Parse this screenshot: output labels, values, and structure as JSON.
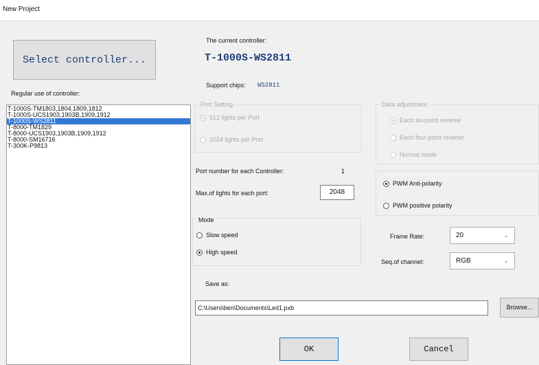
{
  "window": {
    "title": "New Project"
  },
  "select_button": {
    "label": "Select controller..."
  },
  "list": {
    "label": "Regular use of controller:",
    "items": [
      "T-1000S-TM1803,1804,1809,1812",
      "T-1000S-UCS1903,1903B,1909,1912",
      "T-1000S-WS2811",
      "T-8000-TM1829",
      "T-8000-UCS1903,1903B,1909,1912",
      "T-8000-SM16716",
      "T-300K-P9813"
    ],
    "selected_index": 2
  },
  "controller": {
    "current_label": "The current controller:",
    "current_value": "T-1000S-WS2811",
    "chips_label": "Support chips:",
    "chips_value": "WS2811"
  },
  "port_setting": {
    "title": "Port Setting",
    "opt1": "512 lights per Port",
    "opt2": "1024 lights per Port"
  },
  "data_adjustment": {
    "title": "Data adjustment",
    "opt1": "Each six-point reverse",
    "opt2": "Each four-point reverse",
    "opt3": "Normal mode"
  },
  "ports": {
    "label": "Port number for each Controller:",
    "value": "1",
    "max_label": "Max.of lights for each port:",
    "max_value": "2048"
  },
  "polarity": {
    "anti": "PWM Anti-polarity",
    "positive": "PWM positive polarity"
  },
  "mode": {
    "title": "Mode",
    "slow": "Slow speed",
    "high": "High speed"
  },
  "frame_rate": {
    "label": "Frame Rate:",
    "value": "20"
  },
  "channel": {
    "label": "Seq.of channel:",
    "value": "RGB"
  },
  "save": {
    "label": "Save as:",
    "path": "C:\\Users\\ben\\Documents\\Led1.pxb",
    "browse": "Browse..."
  },
  "buttons": {
    "ok": "OK",
    "cancel": "Cancel"
  }
}
